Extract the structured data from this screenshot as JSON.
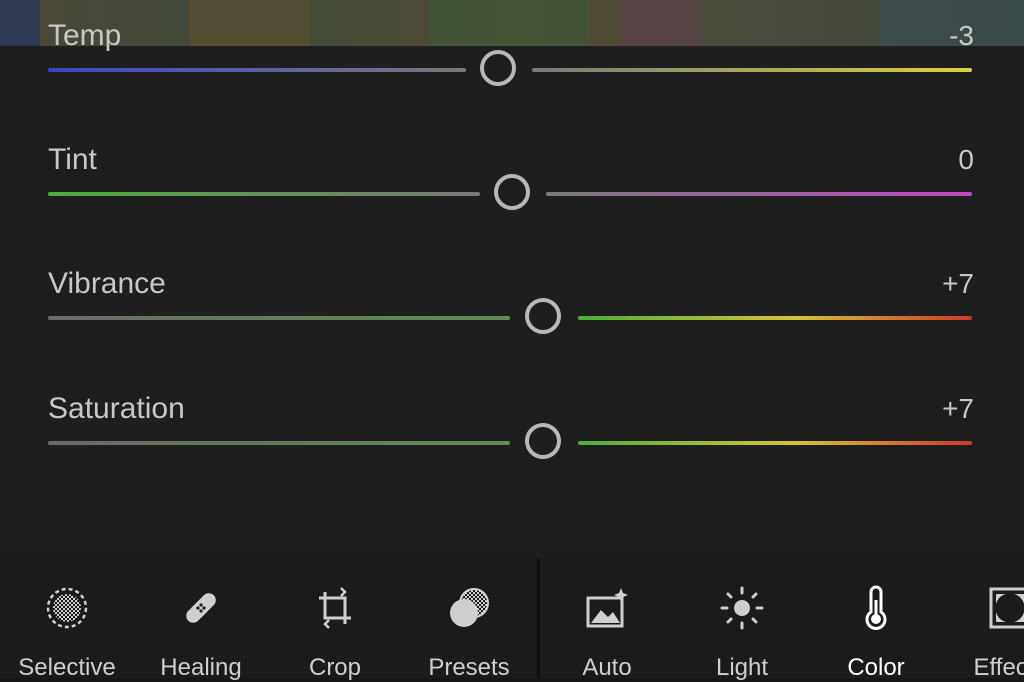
{
  "adjustments": {
    "temp": {
      "label": "Temp",
      "value": "-3",
      "fraction": 0.487
    },
    "tint": {
      "label": "Tint",
      "value": "0",
      "fraction": 0.5
    },
    "vibrance": {
      "label": "Vibrance",
      "value": "+7",
      "fraction": 0.535
    },
    "saturation": {
      "label": "Saturation",
      "value": "+7",
      "fraction": 0.535
    }
  },
  "toolbar": {
    "selective": "Selective",
    "healing": "Healing",
    "crop": "Crop",
    "presets": "Presets",
    "auto": "Auto",
    "light": "Light",
    "color": "Color",
    "effects": "Effects",
    "active_tool": "Color"
  },
  "colors": {
    "background": "#1e1e1e",
    "thumb": "#b8b8b8",
    "temp_left": "#3a45c4",
    "temp_right": "#d8d23e",
    "tint_left": "#4caf3a",
    "tint_right": "#c04ac8",
    "vib_right_start": "#4caf3a",
    "vib_right_mid": "#d6c23a",
    "vib_right_end": "#d03a2a",
    "neutral": "#7a7a7a"
  }
}
